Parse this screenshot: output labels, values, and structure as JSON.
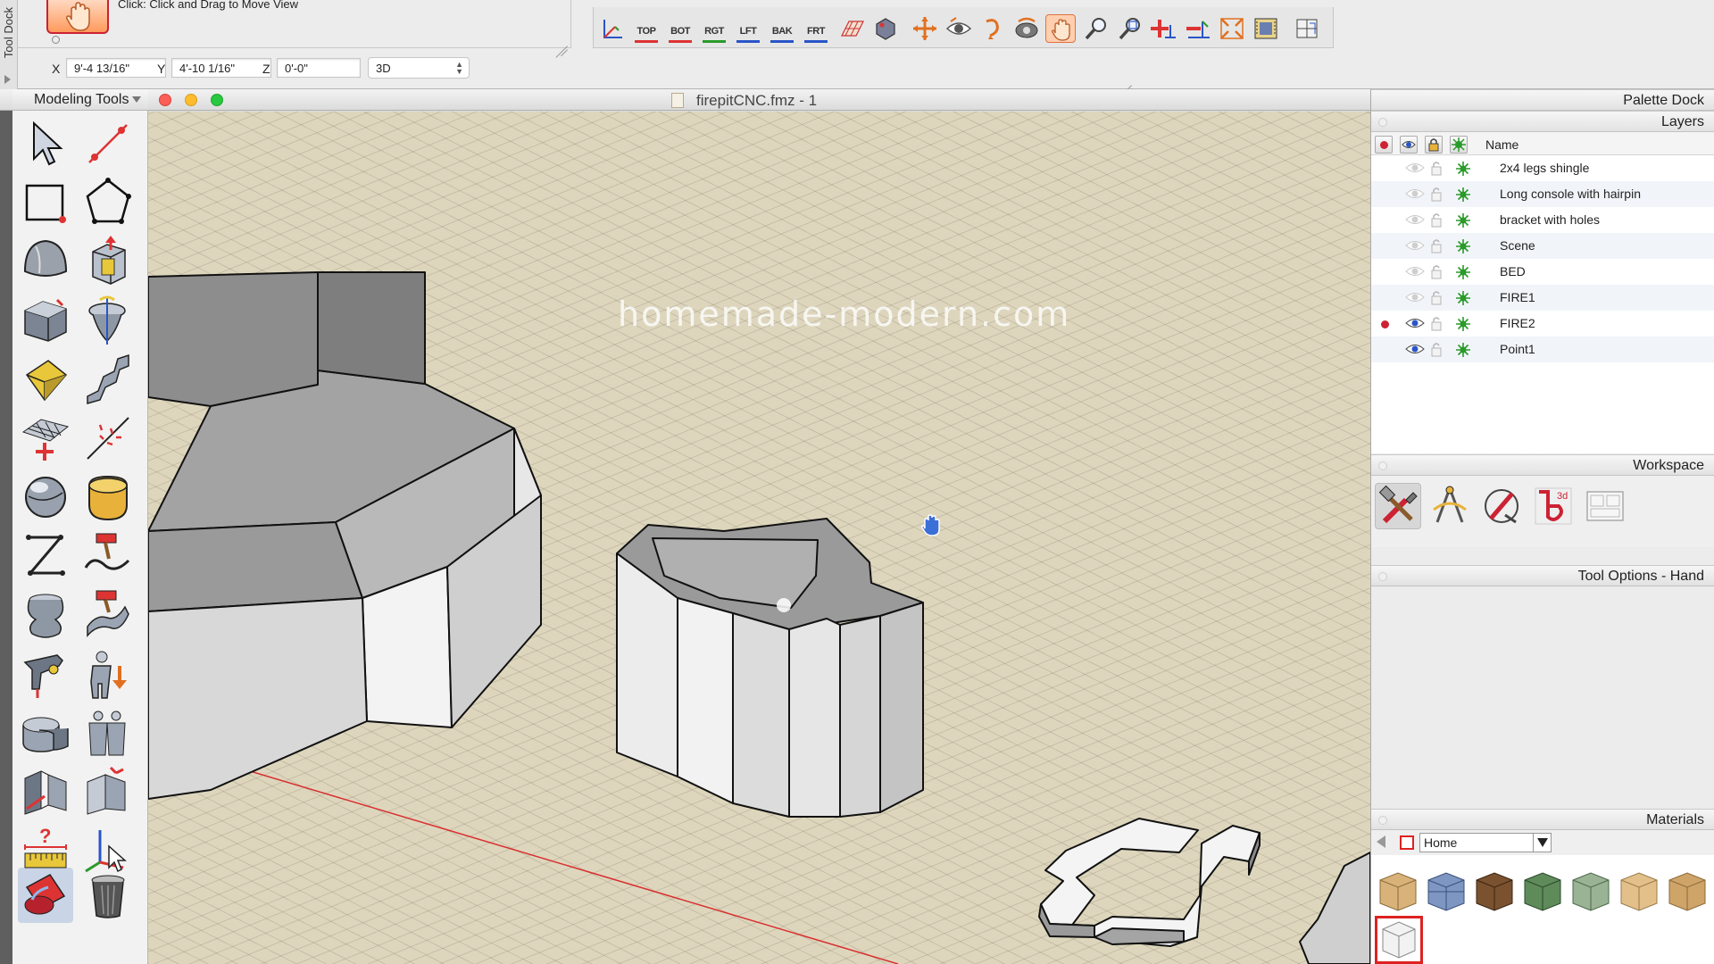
{
  "tooldock": {
    "tab_label": "Tool Dock",
    "hint": "Click: Click and Drag to Move View"
  },
  "coords": {
    "x_label": "X",
    "x_value": "9'-4 13/16\"",
    "y_label": "Y",
    "y_value": "4'-10 1/16\"",
    "z_label": "Z",
    "z_value": "0'-0\"",
    "mode": "3D"
  },
  "viewbar": {
    "views": [
      "TOP",
      "BOT",
      "RGT",
      "LFT",
      "BAK",
      "FRT"
    ]
  },
  "window": {
    "title": "firepitCNC.fmz - 1"
  },
  "modeling_tools": {
    "title": "Modeling Tools"
  },
  "viewport": {
    "watermark": "homemade-modern.com"
  },
  "palette_dock": {
    "title": "Palette Dock",
    "layers_title": "Layers",
    "name_header": "Name",
    "layers": [
      {
        "name": "2x4 legs shingle",
        "visible": false,
        "active": false
      },
      {
        "name": "Long console with hairpin",
        "visible": false,
        "active": false
      },
      {
        "name": "bracket with holes",
        "visible": false,
        "active": false
      },
      {
        "name": "Scene",
        "visible": false,
        "active": false
      },
      {
        "name": "BED",
        "visible": false,
        "active": false
      },
      {
        "name": "FIRE1",
        "visible": false,
        "active": false
      },
      {
        "name": "FIRE2",
        "visible": true,
        "active": true
      },
      {
        "name": "Point1",
        "visible": true,
        "active": false
      }
    ],
    "workspace_title": "Workspace",
    "tool_options_title": "Tool Options - Hand",
    "materials_title": "Materials",
    "materials_category": "Home"
  },
  "colors": {
    "accent_red": "#cc2233",
    "viewport_bg": "#ddd6bd",
    "selection_blue": "#c9d4e6"
  }
}
